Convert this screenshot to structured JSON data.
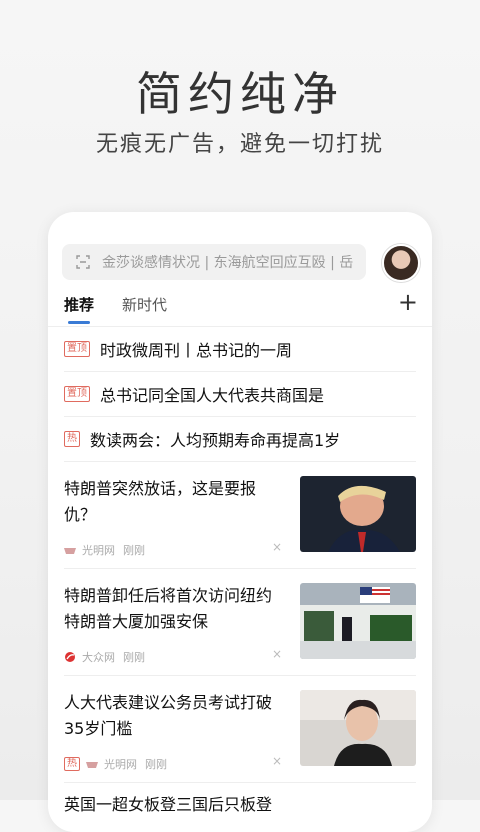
{
  "hero": {
    "title": "简约纯净",
    "subtitle": "无痕无广告，避免一切打扰"
  },
  "search": {
    "placeholder": "金莎谈感情状况 | 东海航空回应互殴 | 岳"
  },
  "tabs": [
    {
      "label": "推荐",
      "active": true
    },
    {
      "label": "新时代",
      "active": false
    }
  ],
  "add_tab": "+",
  "pinned": [
    {
      "tag": "置顶",
      "title": "时政微周刊丨总书记的一周"
    },
    {
      "tag": "置顶",
      "title": "总书记同全国人大代表共商国是"
    },
    {
      "tag": "热",
      "title": "数读两会：人均预期寿命再提高1岁"
    }
  ],
  "news": [
    {
      "title": "特朗普突然放话，这是要报仇？",
      "source": "光明网",
      "time": "刚刚",
      "hot": "",
      "thumb": "trump-portrait"
    },
    {
      "title": "特朗普卸任后将首次访问纽约特朗普大厦加强安保",
      "source": "大众网",
      "time": "刚刚",
      "hot": "",
      "thumb": "helicopter-scene"
    },
    {
      "title": "人大代表建议公务员考试打破35岁门槛",
      "source": "光明网",
      "time": "刚刚",
      "hot": "热",
      "thumb": "woman-speaking"
    }
  ],
  "peek": {
    "title": "英国一超女板登三国后只板登"
  },
  "icons": {
    "close": "×"
  },
  "colors": {
    "accent": "#3a7bd5",
    "tag": "#e06b5f"
  }
}
